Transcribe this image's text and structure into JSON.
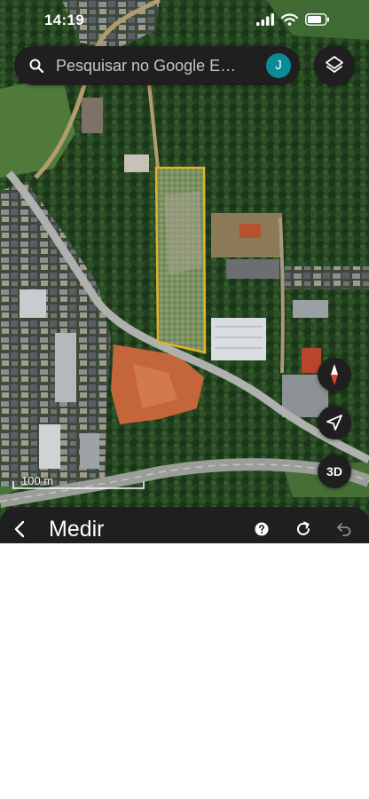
{
  "status": {
    "time": "14:19"
  },
  "search": {
    "placeholder": "Pesquisar no Google E…",
    "avatar_initial": "J"
  },
  "map": {
    "scale_label": "100 m",
    "button_3d": "3D",
    "selection_color": "#e2b22a"
  },
  "bottom_bar": {
    "title": "Medir"
  },
  "colors": {
    "toolbar_bg": "#1f1f1f",
    "avatar_bg": "#0b8a9a"
  }
}
